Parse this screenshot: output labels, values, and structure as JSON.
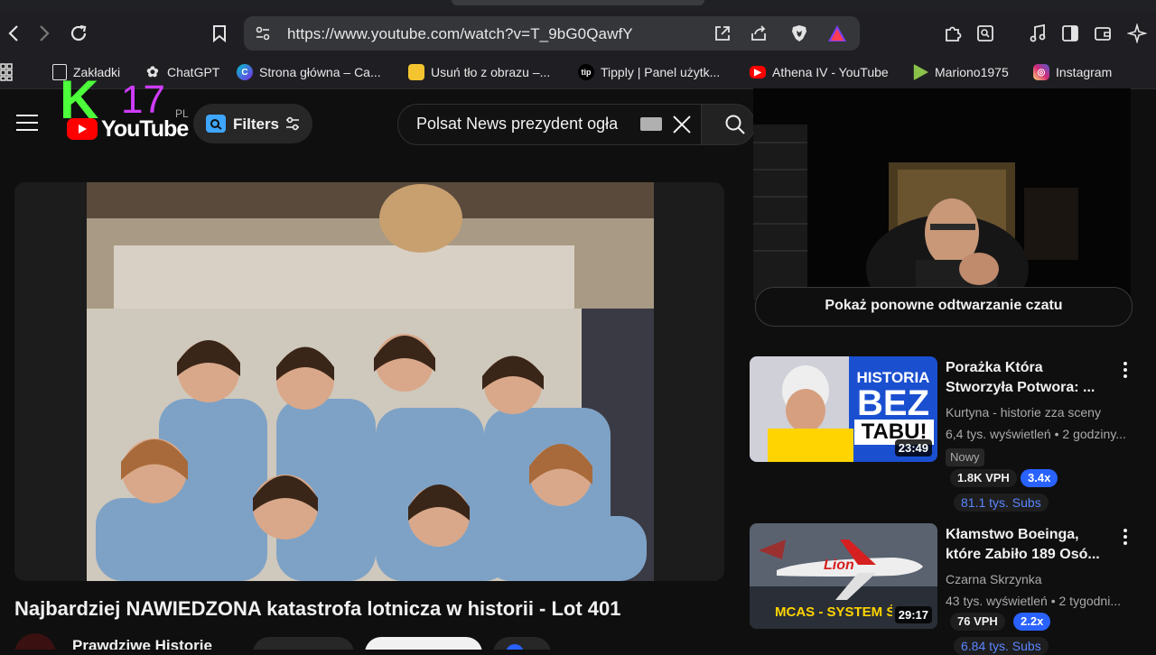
{
  "browser": {
    "url": "https://www.youtube.com/watch?v=T_9bG0QawfY"
  },
  "bookmarks": [
    {
      "label": "Zakładki"
    },
    {
      "label": "ChatGPT"
    },
    {
      "label": "Strona główna – Ca..."
    },
    {
      "label": "Usuń tło z obrazu –..."
    },
    {
      "label": "Tipply | Panel użytk..."
    },
    {
      "label": "Athena IV - YouTube"
    },
    {
      "label": "Mariono1975"
    },
    {
      "label": "Instagram"
    }
  ],
  "youtube": {
    "logo_text": "YouTube",
    "logo_region": "PL",
    "channel_badge": "K",
    "channel_badge_num": "17",
    "filters_label": "Filters",
    "search_value": "Polsat News prezydent ogła",
    "video_title": "Najbardziej NAWIEDZONA katastrofa lotnicza w historii - Lot 401",
    "channel_name": "Prawdziwe Historie",
    "chat_replay_label": "Pokaż ponowne odtwarzanie czatu"
  },
  "sidebar": [
    {
      "title": "Porażka Która Stworzyła Potwora: ...",
      "channel": "Kurtyna - historie zza sceny",
      "meta": "6,4 tys. wyświetleń • 2 godziny...",
      "duration": "23:49",
      "badge": "Nowy",
      "vph": "1.8K VPH",
      "multiplier": "3.4x",
      "subs": "81.1 tys. Subs",
      "thumb_text_1": "HISTORIA",
      "thumb_text_2": "BEZ",
      "thumb_text_3": "TABU!"
    },
    {
      "title": "Kłamstwo Boeinga, które Zabiło 189 Osó...",
      "channel": "Czarna Skrzynka",
      "meta": "43 tys. wyświetleń • 2 tygodni...",
      "duration": "29:17",
      "vph": "76 VPH",
      "multiplier": "2.2x",
      "subs": "6.84 tys. Subs",
      "thumb_text_1": "MCAS - SYSTEM ŚMIE",
      "thumb_text_2": "Lion"
    }
  ],
  "colors": {
    "yt_red": "#ff0000",
    "accent_blue": "#3ea6ff",
    "pill_blue": "#2962ff"
  }
}
